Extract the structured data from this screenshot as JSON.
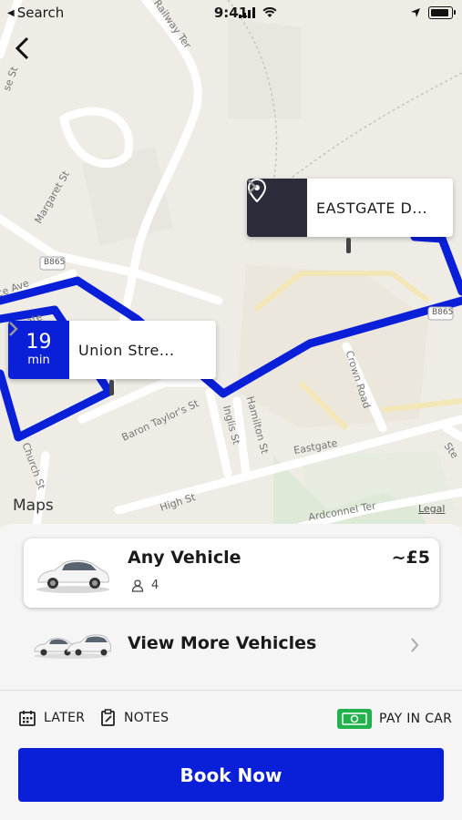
{
  "status_bar": {
    "back_app": "Search",
    "time": "9:41"
  },
  "map": {
    "road_labels": {
      "railway": "Railway Ter",
      "margaret": "Margaret St",
      "b865_a": "B865",
      "b865_b": "B865",
      "ce_ave": "ce Ave",
      "baron": "Baron Taylor's St",
      "inglis": "Inglis St",
      "hamilton": "Hamilton St",
      "crown": "Crown Road",
      "eastgate": "Eastgate",
      "high": "High St",
      "church": "Church St",
      "adconnel": "Ardconnel Ter",
      "ste": "Ste",
      "se_st": "se St",
      "gate": "gate"
    },
    "destination_label": "EASTGATE D...",
    "origin_minutes": "19",
    "origin_unit": "min",
    "origin_label": "Union Stre...",
    "maps_brand": "Maps",
    "legal": "Legal"
  },
  "vehicle": {
    "name": "Any Vehicle",
    "price": "~£5",
    "seats": "4"
  },
  "more_vehicles": {
    "label": "View More Vehicles"
  },
  "options": {
    "later": "LATER",
    "notes": "NOTES",
    "payment": "PAY IN CAR"
  },
  "book_button": "Book Now",
  "colors": {
    "accent": "#0a1fd8",
    "route": "#0a1fd8",
    "pin_dark": "#2b2b3a",
    "pay_green": "#22b14c"
  }
}
